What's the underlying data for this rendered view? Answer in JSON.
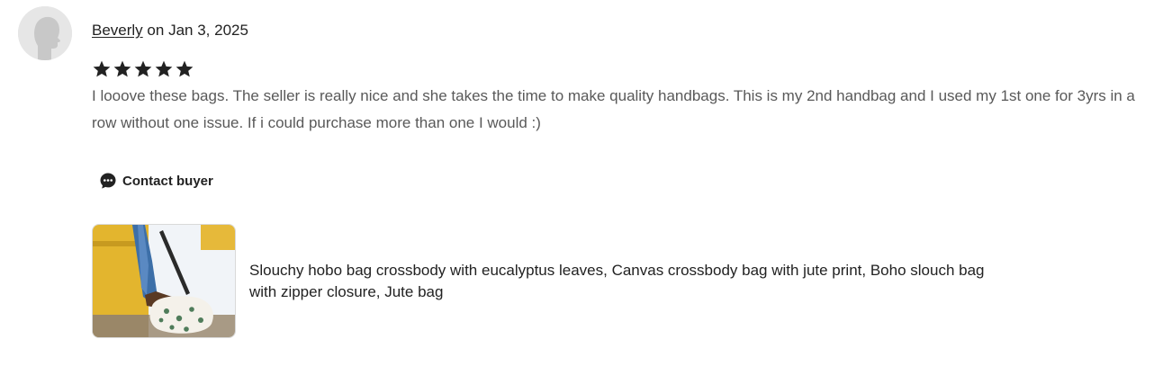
{
  "review": {
    "reviewer_name": "Beverly",
    "date_prefix": "on",
    "date": "Jan 3, 2025",
    "rating": 5,
    "rating_max": 5,
    "star_icon": "star-icon",
    "text": "I looove these bags. The seller is really nice and she takes the time to make quality handbags. This is my 2nd handbag and I used my 1st one for 3yrs in a row without one issue. If i could purchase more than one I would :)",
    "avatar_icon": "user-silhouette-icon"
  },
  "actions": {
    "contact_label": "Contact buyer",
    "contact_icon": "chat-bubble-icon"
  },
  "listing": {
    "title": "Slouchy hobo bag crossbody with eucalyptus leaves, Canvas crossbody bag with jute print, Boho slouch bag with zipper closure, Jute bag"
  },
  "colors": {
    "text_primary": "#222222",
    "text_secondary": "#595959",
    "avatar_bg": "#e6e6e6"
  }
}
